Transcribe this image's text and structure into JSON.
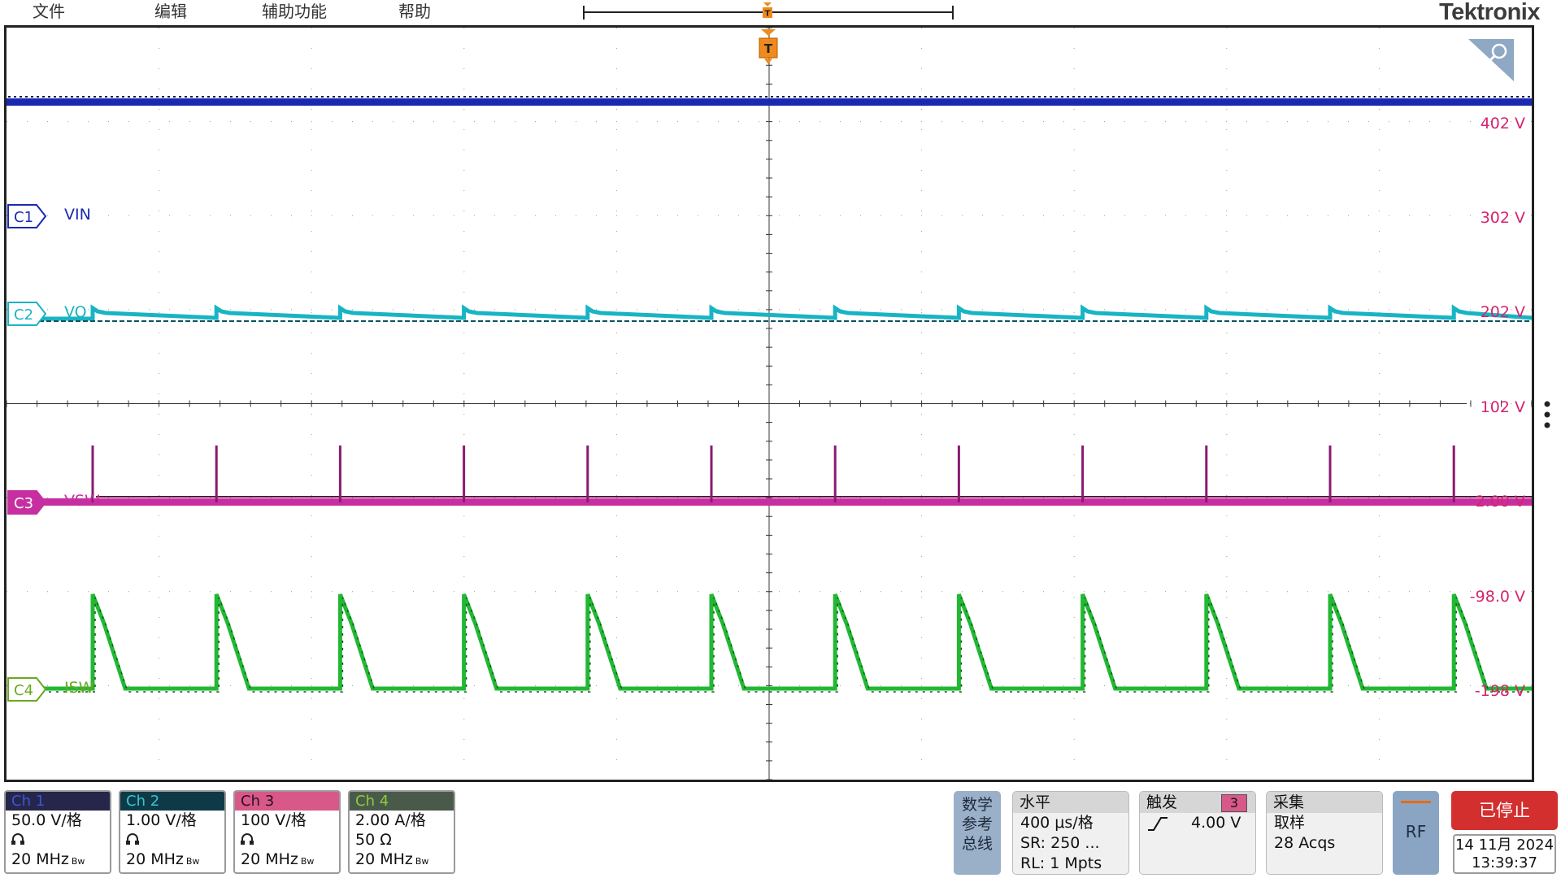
{
  "menu": {
    "items": [
      "文件",
      "编辑",
      "辅助功能",
      "帮助"
    ]
  },
  "brand": {
    "name": "Tektronix"
  },
  "trigger": {
    "marker_label": "T"
  },
  "channels": [
    {
      "id": "C1",
      "name": "VIN",
      "color": "#1a2ab0",
      "scale": "50.0 V/格",
      "line2": "",
      "bw": "20 MHz",
      "header": "Ch 1",
      "header_bg": "#26264a",
      "header_fg": "#3c55d8"
    },
    {
      "id": "C2",
      "name": "VO",
      "color": "#18b4c4",
      "scale": "1.00 V/格",
      "line2": "",
      "bw": "20 MHz",
      "header": "Ch 2",
      "header_bg": "#0e3a48",
      "header_fg": "#3cc4d4"
    },
    {
      "id": "C3",
      "name": "VSW",
      "color": "#c72fa0",
      "scale": "100 V/格",
      "line2": "",
      "bw": "20 MHz",
      "header": "Ch 3",
      "header_bg": "#d8588a",
      "header_fg": "#2a1020"
    },
    {
      "id": "C4",
      "name": "ISW",
      "color": "#22b834",
      "scale": "2.00 A/格",
      "line2": "50 Ω",
      "bw": "20 MHz",
      "header": "Ch 4",
      "header_bg": "#4a5a4a",
      "header_fg": "#8ccc3c"
    }
  ],
  "bw_suffix": "Bw",
  "vlabels": [
    "402 V",
    "302 V",
    "202 V",
    "102 V",
    "2.00 V",
    "-98.0 V",
    "-198 V"
  ],
  "math_ref_bus": {
    "lines": [
      "数学",
      "参考",
      "总线"
    ]
  },
  "horizontal": {
    "title": "水平",
    "scale": "400 μs/格",
    "sr": "SR: 250 ...",
    "rl": "RL: 1 Mpts"
  },
  "trigger_panel": {
    "title": "触发",
    "channel": "3",
    "level": "4.00 V"
  },
  "acquisition": {
    "title": "采集",
    "mode": "取样",
    "count": "28 Acqs"
  },
  "rf_button": {
    "label": "RF"
  },
  "run_status": {
    "label": "已停止"
  },
  "datetime": {
    "date": "14 11月 2024",
    "time": "13:39:37"
  },
  "colors": {
    "vlabel": "#d6246e",
    "trigger": "#f08a1c",
    "grid": "#9a9a9a"
  }
}
